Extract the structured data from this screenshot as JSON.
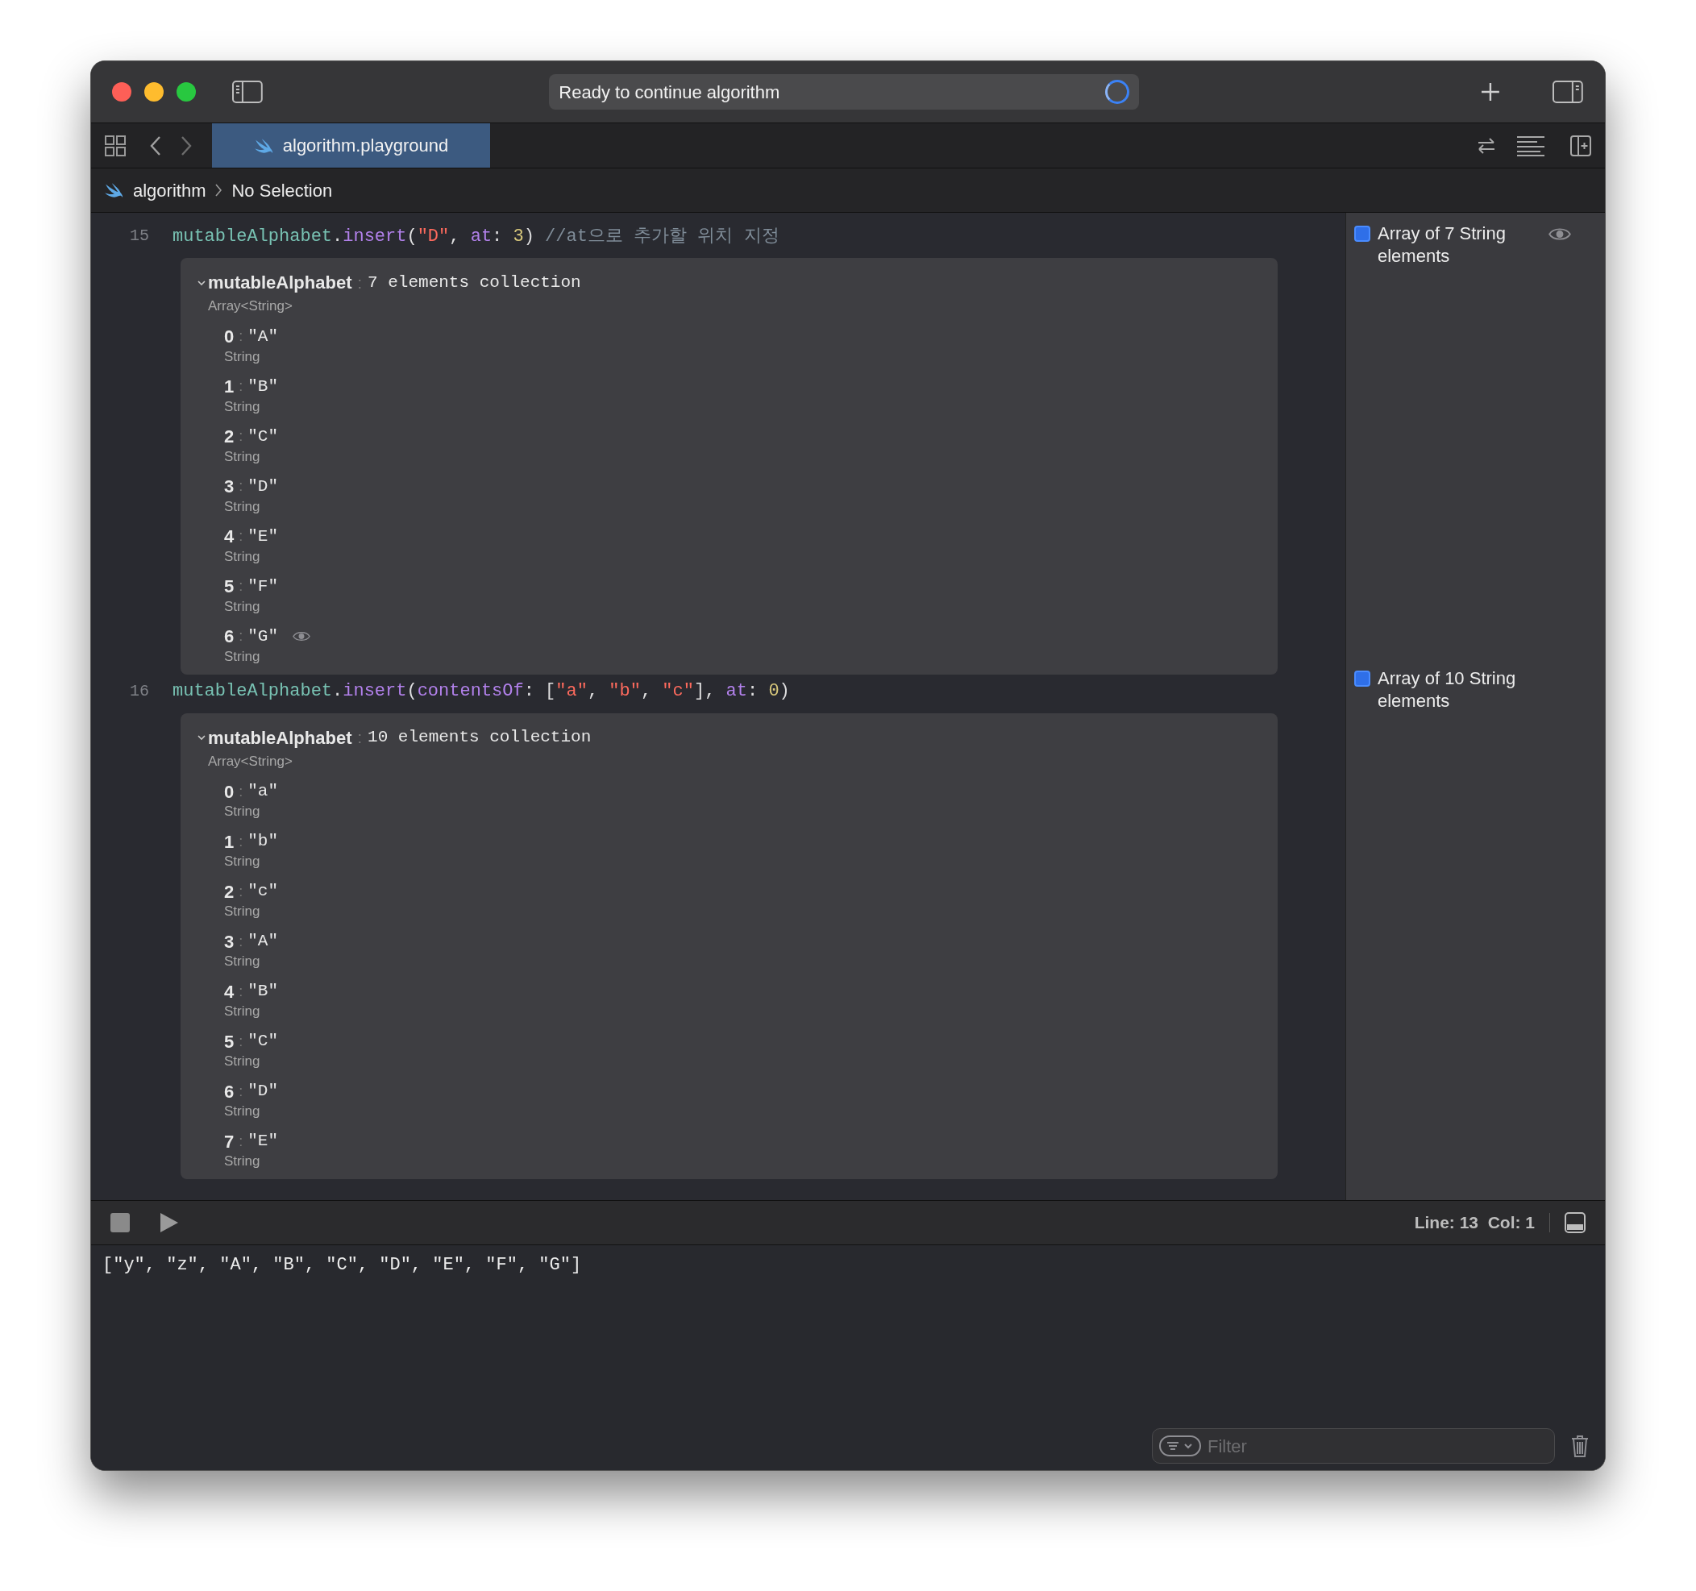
{
  "toolbar": {
    "status": "Ready to continue algorithm"
  },
  "tabs": [
    {
      "label": "algorithm.playground",
      "selected": true
    }
  ],
  "breadcrumb": [
    "algorithm",
    "No Selection"
  ],
  "lines": [
    {
      "number": "15",
      "tokens": [
        {
          "kind": "var",
          "text": "mutableAlphabet"
        },
        {
          "kind": "plain",
          "text": "."
        },
        {
          "kind": "method",
          "text": "insert"
        },
        {
          "kind": "plain",
          "text": "("
        },
        {
          "kind": "string",
          "text": "\"D\""
        },
        {
          "kind": "plain",
          "text": ", "
        },
        {
          "kind": "label",
          "text": "at"
        },
        {
          "kind": "plain",
          "text": ": "
        },
        {
          "kind": "number",
          "text": "3"
        },
        {
          "kind": "plain",
          "text": ") "
        },
        {
          "kind": "comment",
          "text": "//at으로 추가할 위치 지정"
        }
      ],
      "result": {
        "name": "mutableAlphabet",
        "colon": ":",
        "summary": "7 elements collection",
        "type": "Array<String>",
        "expanded": true,
        "items": [
          {
            "index": "0",
            "colon": ":",
            "value": "\"A\"",
            "type": "String",
            "quick_look": false
          },
          {
            "index": "1",
            "colon": ":",
            "value": "\"B\"",
            "type": "String",
            "quick_look": false
          },
          {
            "index": "2",
            "colon": ":",
            "value": "\"C\"",
            "type": "String",
            "quick_look": false
          },
          {
            "index": "3",
            "colon": ":",
            "value": "\"D\"",
            "type": "String",
            "quick_look": false
          },
          {
            "index": "4",
            "colon": ":",
            "value": "\"E\"",
            "type": "String",
            "quick_look": false
          },
          {
            "index": "5",
            "colon": ":",
            "value": "\"F\"",
            "type": "String",
            "quick_look": false
          },
          {
            "index": "6",
            "colon": ":",
            "value": "\"G\"",
            "type": "String",
            "quick_look": true
          }
        ]
      },
      "sidebar": {
        "text": "Array of 7 String elements",
        "quick_look": true
      }
    },
    {
      "number": "16",
      "tokens": [
        {
          "kind": "var",
          "text": "mutableAlphabet"
        },
        {
          "kind": "plain",
          "text": "."
        },
        {
          "kind": "method",
          "text": "insert"
        },
        {
          "kind": "plain",
          "text": "("
        },
        {
          "kind": "label",
          "text": "contentsOf"
        },
        {
          "kind": "plain",
          "text": ": ["
        },
        {
          "kind": "string",
          "text": "\"a\""
        },
        {
          "kind": "plain",
          "text": ", "
        },
        {
          "kind": "string",
          "text": "\"b\""
        },
        {
          "kind": "plain",
          "text": ", "
        },
        {
          "kind": "string",
          "text": "\"c\""
        },
        {
          "kind": "plain",
          "text": "], "
        },
        {
          "kind": "label",
          "text": "at"
        },
        {
          "kind": "plain",
          "text": ": "
        },
        {
          "kind": "number",
          "text": "0"
        },
        {
          "kind": "plain",
          "text": ")"
        }
      ],
      "result": {
        "name": "mutableAlphabet",
        "colon": ":",
        "summary": "10 elements collection",
        "type": "Array<String>",
        "expanded": true,
        "items": [
          {
            "index": "0",
            "colon": ":",
            "value": "\"a\"",
            "type": "String"
          },
          {
            "index": "1",
            "colon": ":",
            "value": "\"b\"",
            "type": "String"
          },
          {
            "index": "2",
            "colon": ":",
            "value": "\"c\"",
            "type": "String"
          },
          {
            "index": "3",
            "colon": ":",
            "value": "\"A\"",
            "type": "String"
          },
          {
            "index": "4",
            "colon": ":",
            "value": "\"B\"",
            "type": "String"
          },
          {
            "index": "5",
            "colon": ":",
            "value": "\"C\"",
            "type": "String"
          },
          {
            "index": "6",
            "colon": ":",
            "value": "\"D\"",
            "type": "String"
          },
          {
            "index": "7",
            "colon": ":",
            "value": "\"E\"",
            "type": "String"
          }
        ]
      },
      "sidebar": {
        "text": "Array of 10 String elements",
        "quick_look": false
      }
    }
  ],
  "debug_bar": {
    "position": "Line: 13  Col: 1"
  },
  "console": {
    "output": "[\"y\", \"z\", \"A\", \"B\", \"C\", \"D\", \"E\", \"F\", \"G\"]",
    "filter_placeholder": "Filter"
  }
}
